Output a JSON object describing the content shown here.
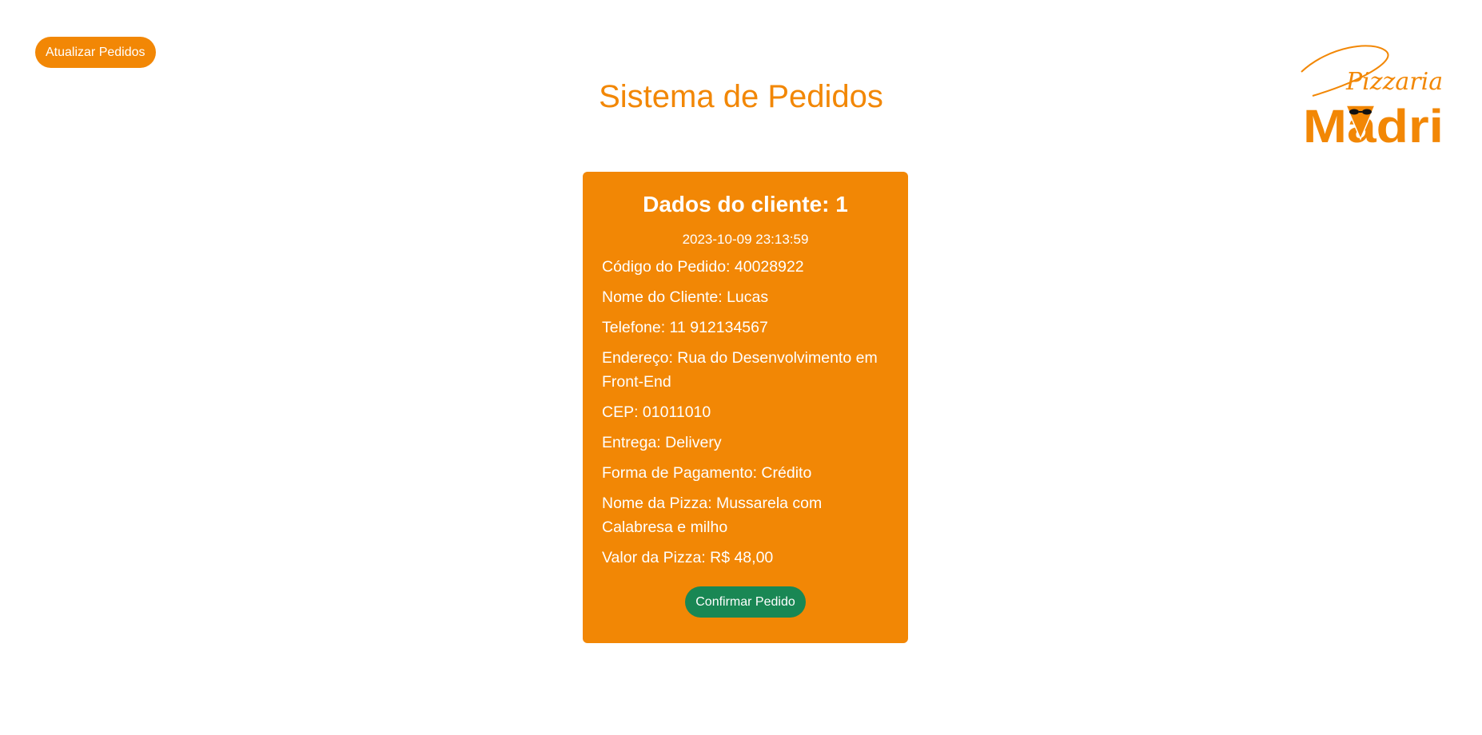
{
  "header": {
    "refresh_label": "Atualizar Pedidos",
    "title": "Sistema de Pedidos"
  },
  "logo": {
    "script_text": "Pizzaria",
    "brand_text": "Madri",
    "brand_color": "#f28705"
  },
  "order": {
    "title": "Dados do cliente: 1",
    "timestamp": "2023-10-09 23:13:59",
    "fields": [
      "Código do Pedido: 40028922",
      "Nome do Cliente: Lucas",
      "Telefone: 11 912134567",
      "Endereço: Rua do Desenvolvimento em Front-End",
      "CEP: 01011010",
      "Entrega: Delivery",
      "Forma de Pagamento: Crédito",
      "Nome da Pizza: Mussarela com Calabresa e milho",
      "Valor da Pizza: R$ 48,00"
    ],
    "confirm_label": "Confirmar Pedido"
  },
  "colors": {
    "accent": "#f28705",
    "confirm": "#198754",
    "background": "#ffffff"
  }
}
